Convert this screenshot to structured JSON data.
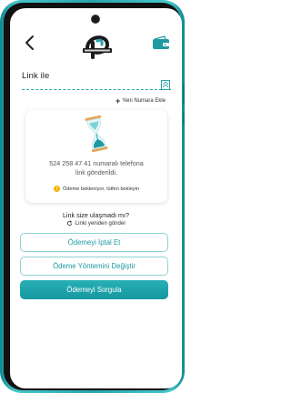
{
  "header": {
    "back_icon": "chevron-left-icon",
    "logo_icon": "app-logo-icon",
    "wallet_icon": "wallet-icon"
  },
  "section": {
    "title": "Link ile",
    "flag_icon": "flag-icon",
    "add_number_label": "Yeni Numara Ekle"
  },
  "status_card": {
    "icon": "hourglass-icon",
    "message_line1": "524 258 47 41 numaralı telefona",
    "message_line2": "link gönderildi.",
    "status_text": "Ödeme bekleniyor, lütfen bekleyin",
    "status_icon": "warning-icon"
  },
  "resend": {
    "question": "Link size ulaşmadı mı?",
    "resend_label": "Linki yeniden gönder",
    "icon": "refresh-icon"
  },
  "buttons": {
    "cancel_label": "Ödemeyi İptal Et",
    "change_method_label": "Ödeme Yöntemini Değiştir",
    "query_label": "Ödemeyi Sorgula"
  },
  "colors": {
    "accent": "#1f9aa1",
    "accent_light": "#8fd2d5",
    "warning": "#f4b400",
    "phone_frame": "#2aa5ab"
  }
}
